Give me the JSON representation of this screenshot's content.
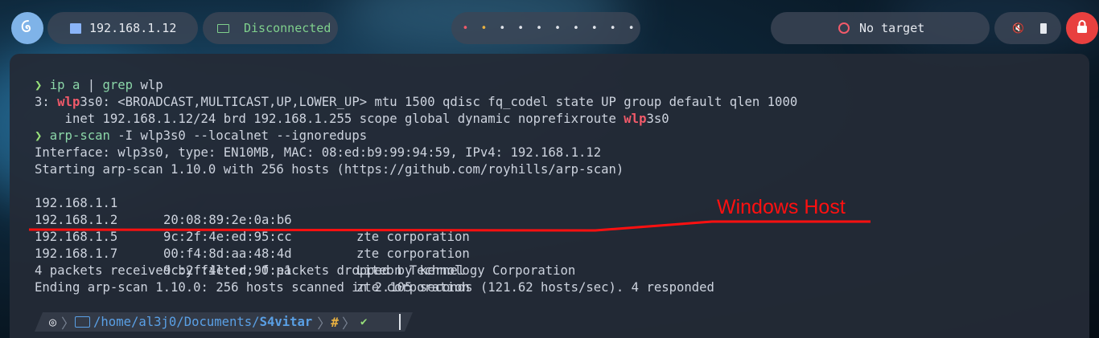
{
  "topbar": {
    "ip_label": "192.168.1.12",
    "vpn_status": "Disconnected",
    "target_label": "No target",
    "workspaces": [
      "•",
      "•",
      "•",
      "•",
      "•",
      "•",
      "•",
      "•",
      "•",
      "•"
    ]
  },
  "terminal": {
    "prompt_arrow": "❯",
    "cmd1_a": "ip a",
    "cmd1_pipe": " | ",
    "cmd1_b": "grep",
    "cmd1_c": " wlp",
    "out1_a": "3: ",
    "out1_b": "wlp",
    "out1_c": "3s0: <BROADCAST,MULTICAST,UP,LOWER_UP> mtu 1500 qdisc fq_codel state UP group default qlen 1000",
    "out2_a": "    inet 192.168.1.12/24 brd 192.168.1.255 scope global dynamic noprefixroute ",
    "out2_b": "wlp",
    "out2_c": "3s0",
    "cmd2_a": "arp-scan",
    "cmd2_b": " -I wlp3s0 --localnet --ignoredups",
    "out3": "Interface: wlp3s0, type: EN10MB, MAC: 08:ed:b9:99:94:59, IPv4: 192.168.1.12",
    "out4": "Starting arp-scan 1.10.0 with 256 hosts (https://github.com/royhills/arp-scan)",
    "hosts": [
      {
        "ip": "192.168.1.1",
        "mac": "20:08:89:2e:0a:b6",
        "vendor": "zte corporation"
      },
      {
        "ip": "192.168.1.2",
        "mac": "9c:2f:4e:ed:95:cc",
        "vendor": "zte corporation"
      },
      {
        "ip": "192.168.1.5",
        "mac": "00:f4:8d:aa:48:4d",
        "vendor": "Liteon Technology Corporation"
      },
      {
        "ip": "192.168.1.7",
        "mac": "9c:2f:4e:ed:9f:e1",
        "vendor": "zte corporation"
      }
    ],
    "out5": "4 packets received by filter, 0 packets dropped by kernel",
    "out6": "Ending arp-scan 1.10.0: 256 hosts scanned in 2.105 seconds (121.62 hosts/sec). 4 responded",
    "prompt_path_a": "/home/al3j0/Documents/",
    "prompt_path_b": "S4vitar",
    "prompt_hash": "#",
    "prompt_check": "✔"
  },
  "annotation": {
    "text": "Windows Host",
    "color": "#ff1010"
  },
  "colors": {
    "accent_green": "#98e07a",
    "red": "#f25a6a",
    "lock_button": "#e8403f"
  }
}
